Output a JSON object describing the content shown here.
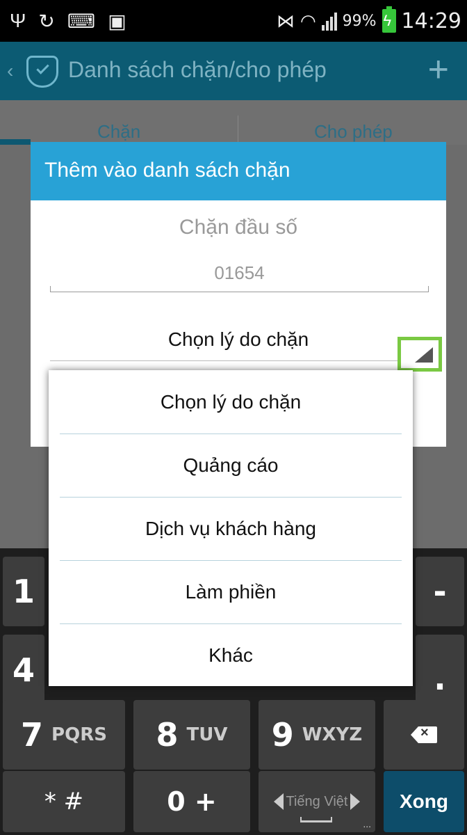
{
  "status_bar": {
    "battery_percent": "99%",
    "time": "14:29",
    "icons": [
      "usb-icon",
      "sync-icon",
      "keyboard-icon",
      "shopping-bag-icon",
      "mute-icon",
      "wifi-icon",
      "signal-icon",
      "battery-charging-icon"
    ]
  },
  "app_bar": {
    "title": "Danh sách chặn/cho phép",
    "add_label": "+"
  },
  "tabs": [
    {
      "label": "Chặn"
    },
    {
      "label": "Cho phép"
    }
  ],
  "dialog": {
    "title": "Thêm vào danh sách chặn",
    "subtitle": "Chặn đầu số",
    "number_value": "01654",
    "reason_selected": "Chọn lý do chặn"
  },
  "dropdown": {
    "options": [
      {
        "label": "Chọn lý do chặn"
      },
      {
        "label": "Quảng cáo"
      },
      {
        "label": "Dịch vụ khách hàng"
      },
      {
        "label": "Làm phiền"
      },
      {
        "label": "Khác"
      }
    ]
  },
  "keyboard": {
    "key_1": "1",
    "key_4": "4",
    "key_7": "7",
    "key_7_letters": "PQRS",
    "key_8": "8",
    "key_8_letters": "TUV",
    "key_9": "9",
    "key_9_letters": "WXYZ",
    "key_star": "* #",
    "key_0": "0 +",
    "key_language": "Tiếng Việt",
    "key_done": "Xong",
    "key_dash": "-",
    "key_dot": ".",
    "key_dots": "..."
  },
  "colors": {
    "app_bar": "#0c5b73",
    "dialog_header": "#28a2d6",
    "done_key": "#0d4d6a",
    "highlight": "#7ac943"
  }
}
